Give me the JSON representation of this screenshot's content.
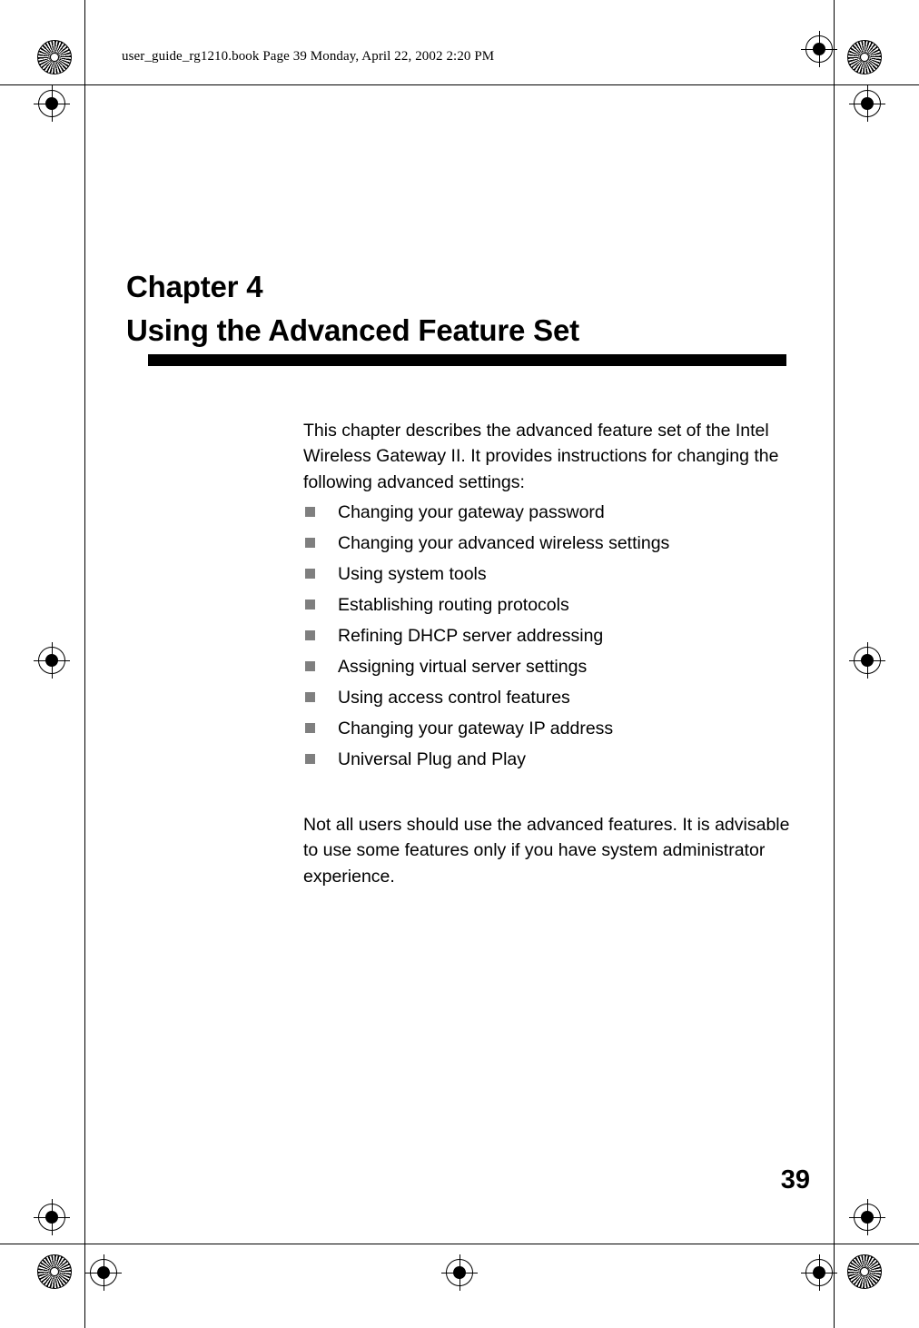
{
  "header": {
    "slug": "user_guide_rg1210.book  Page 39  Monday, April 22, 2002  2:20 PM"
  },
  "chapter": {
    "label": "Chapter 4",
    "title": "Using the Advanced Feature Set"
  },
  "intro_paragraph": "This chapter describes the advanced feature set of the Intel Wireless Gateway II. It provides instructions for changing the following advanced settings:",
  "bullets": [
    "Changing your gateway password",
    "Changing your advanced wireless settings",
    "Using system tools",
    "Establishing routing protocols",
    "Refining DHCP server addressing",
    "Assigning virtual server settings",
    "Using access control features",
    "Changing your gateway IP address",
    "Universal Plug and Play"
  ],
  "outro_paragraph": "Not all users should use the advanced features. It is advisable to use some features only if you have system administrator experience.",
  "page_number": "39",
  "colors": {
    "bullet_square": "#7f7f7f",
    "rule": "#000000",
    "text": "#000000",
    "background": "#ffffff"
  }
}
